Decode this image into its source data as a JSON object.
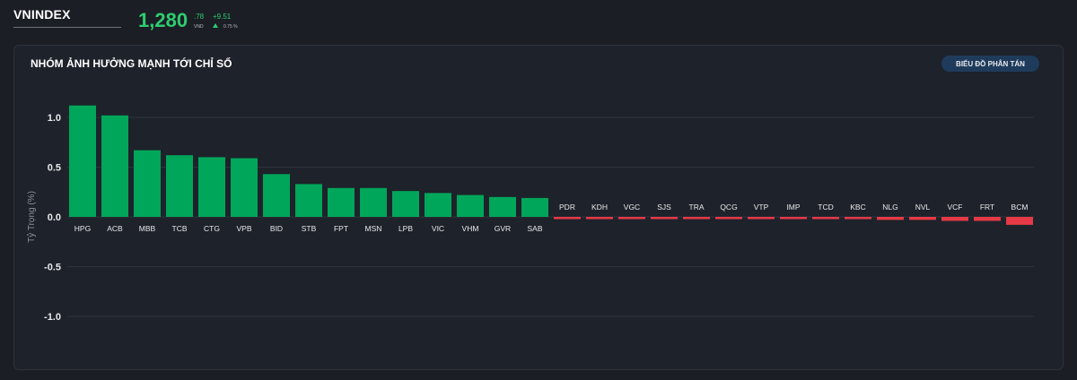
{
  "header": {
    "index_name": "VNINDEX",
    "price_main": "1,280",
    "price_frac": ".78",
    "price_unit": "VND",
    "change": "+9.51",
    "change_pct": "0.75 %"
  },
  "panel": {
    "title": "NHÓM ẢNH HƯỞNG MẠNH TỚI CHỈ SỐ",
    "scatter_button_label": "BIỂU ĐỒ PHÂN TÁN"
  },
  "colors": {
    "positive": "#00a65a",
    "negative": "#e63946",
    "grid": "#2f343d",
    "background": "#1b1e25"
  },
  "chart_data": {
    "type": "bar",
    "ylabel": "Tỷ Trọng (%)",
    "ylim": [
      -1.1,
      1.1
    ],
    "yticks": [
      1.0,
      0.5,
      0.0,
      -0.5,
      -1.0
    ],
    "grid": true,
    "categories": [
      "HPG",
      "ACB",
      "MBB",
      "TCB",
      "CTG",
      "VPB",
      "BID",
      "STB",
      "FPT",
      "MSN",
      "LPB",
      "VIC",
      "VHM",
      "GVR",
      "SAB",
      "PDR",
      "KDH",
      "VGC",
      "SJS",
      "TRA",
      "QCG",
      "VTP",
      "IMP",
      "TCD",
      "KBC",
      "NLG",
      "NVL",
      "VCF",
      "FRT",
      "BCM"
    ],
    "values": [
      1.12,
      1.02,
      0.67,
      0.62,
      0.6,
      0.59,
      0.43,
      0.33,
      0.29,
      0.29,
      0.26,
      0.24,
      0.22,
      0.2,
      0.19,
      -0.01,
      -0.01,
      -0.01,
      -0.01,
      -0.01,
      -0.02,
      -0.02,
      -0.02,
      -0.02,
      -0.02,
      -0.03,
      -0.03,
      -0.04,
      -0.04,
      -0.08
    ]
  }
}
